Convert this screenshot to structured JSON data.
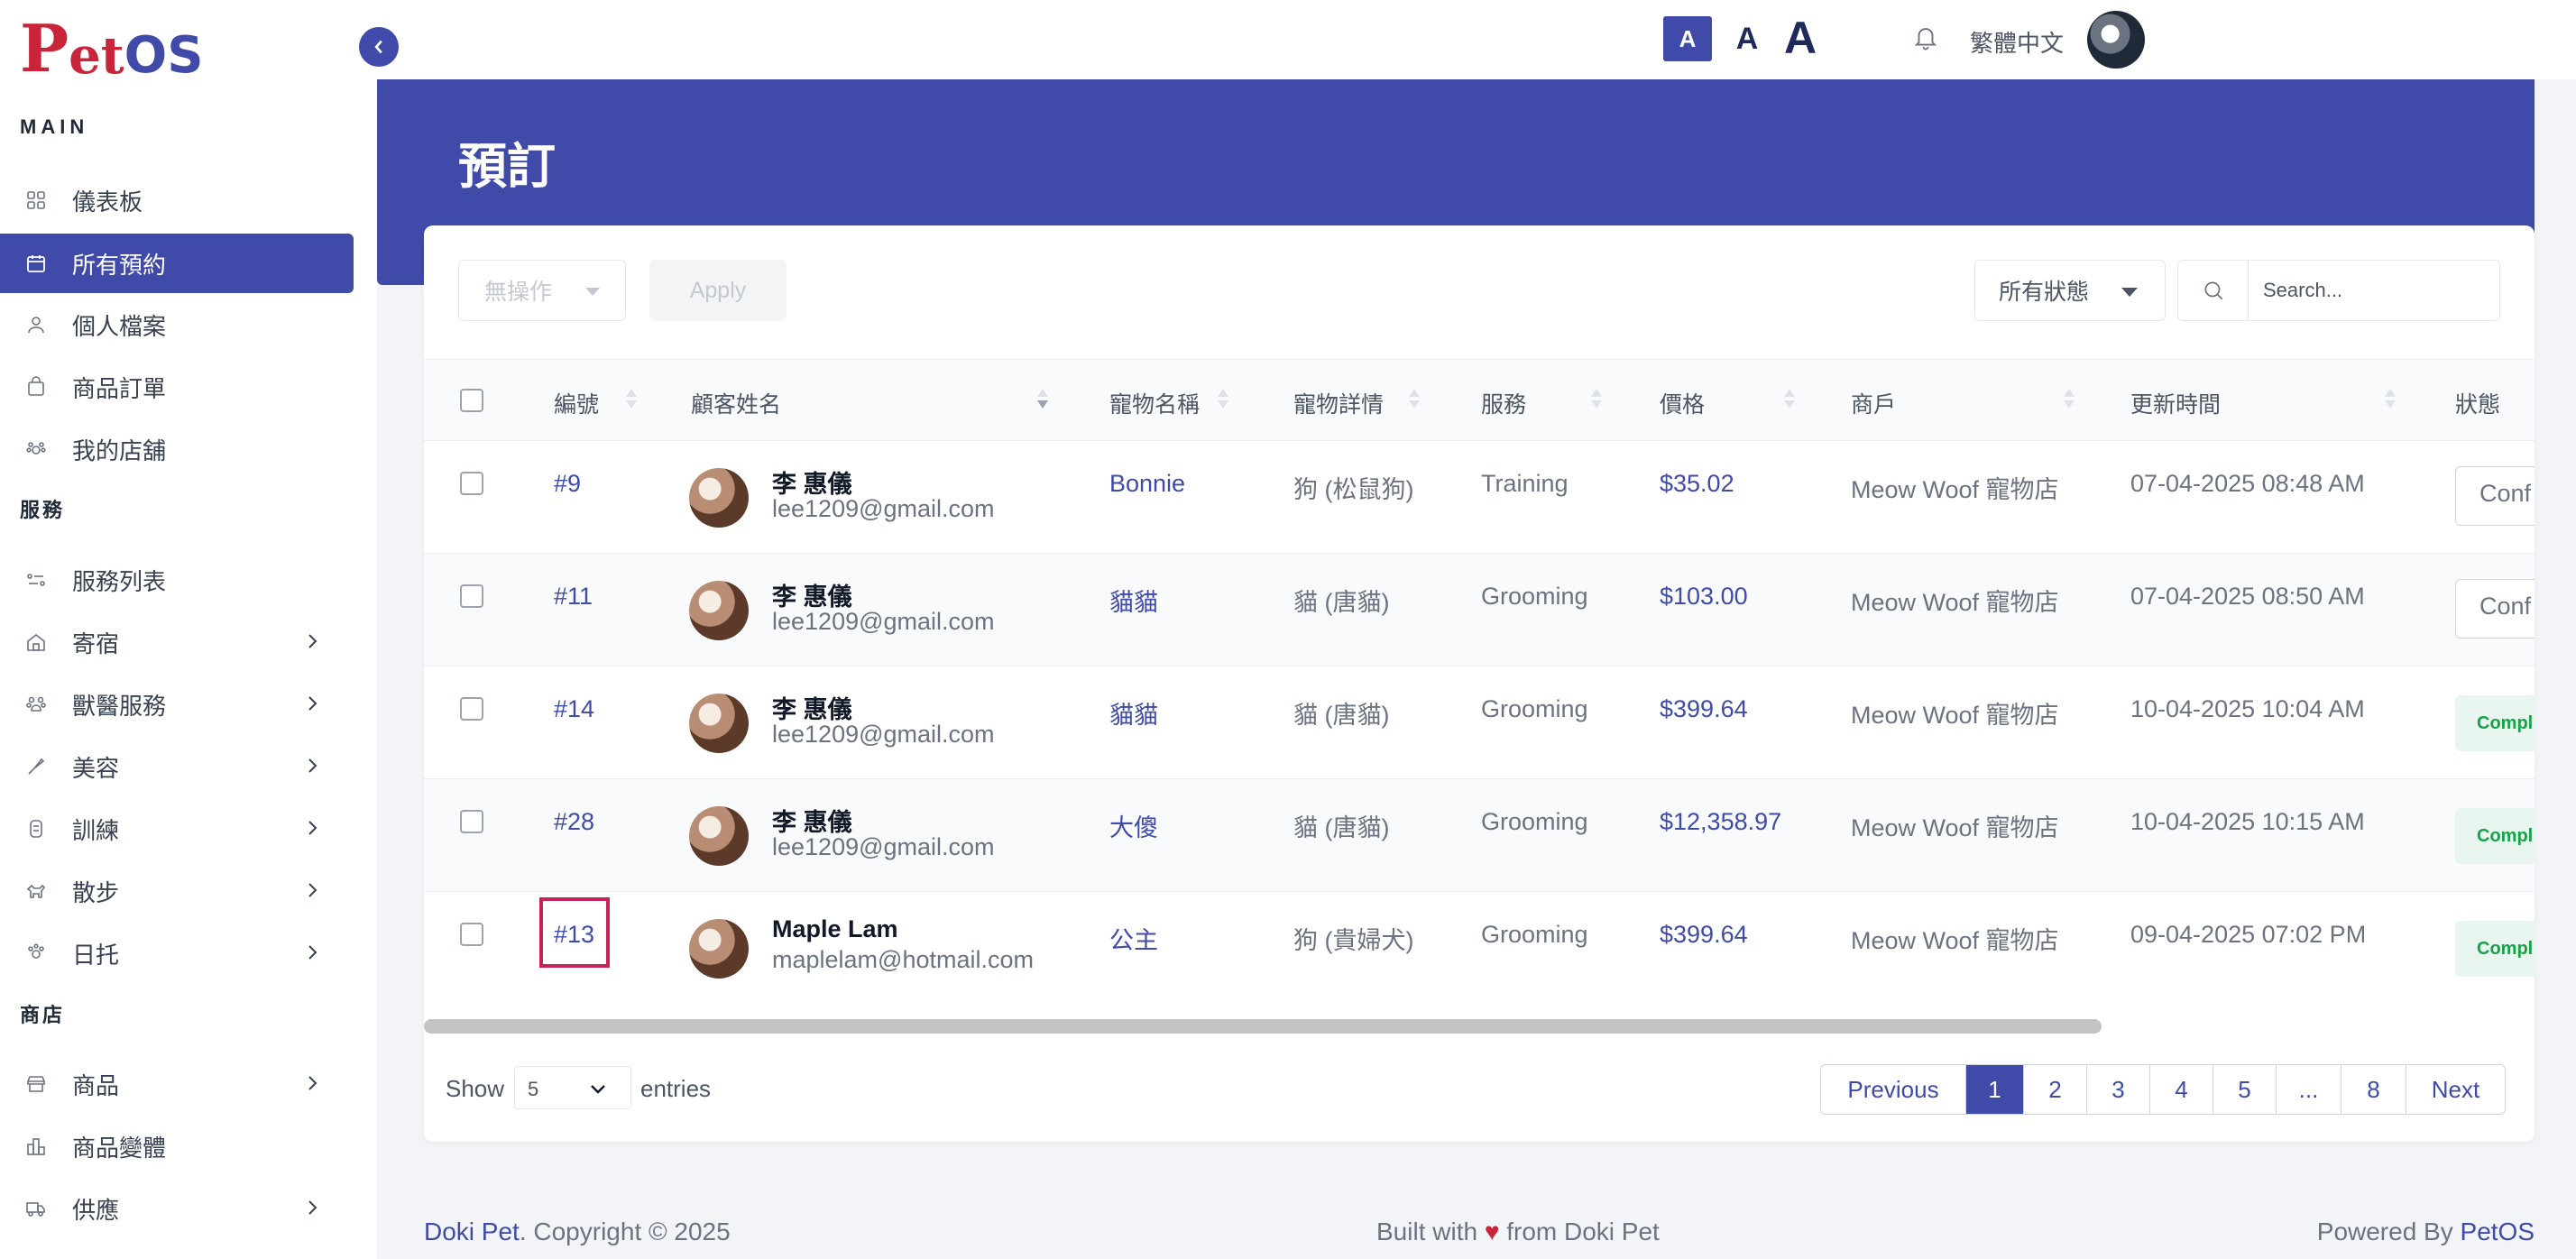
{
  "brand": {
    "logo_p": "P",
    "logo_et": "et",
    "logo_os": "OS"
  },
  "topbar": {
    "font_small": "A",
    "font_medium": "A",
    "font_large": "A",
    "language": "繁體中文"
  },
  "sidebar": {
    "sections": [
      {
        "label": "MAIN"
      },
      {
        "label": "服務"
      },
      {
        "label": "商店"
      }
    ],
    "items": [
      {
        "label": "儀表板",
        "icon": "dashboard-icon",
        "active": false,
        "has_children": false
      },
      {
        "label": "所有預約",
        "icon": "calendar-icon",
        "active": true,
        "has_children": false
      },
      {
        "label": "個人檔案",
        "icon": "user-icon",
        "active": false,
        "has_children": false
      },
      {
        "label": "商品訂單",
        "icon": "bag-icon",
        "active": false,
        "has_children": false
      },
      {
        "label": "我的店舖",
        "icon": "store-icon",
        "active": false,
        "has_children": false
      },
      {
        "label": "服務列表",
        "icon": "list-icon",
        "active": false,
        "has_children": false
      },
      {
        "label": "寄宿",
        "icon": "home-icon",
        "active": false,
        "has_children": true
      },
      {
        "label": "獸醫服務",
        "icon": "vet-icon",
        "active": false,
        "has_children": true
      },
      {
        "label": "美容",
        "icon": "grooming-icon",
        "active": false,
        "has_children": true
      },
      {
        "label": "訓練",
        "icon": "training-icon",
        "active": false,
        "has_children": true
      },
      {
        "label": "散步",
        "icon": "walk-icon",
        "active": false,
        "has_children": true
      },
      {
        "label": "日托",
        "icon": "daycare-icon",
        "active": false,
        "has_children": true
      },
      {
        "label": "商品",
        "icon": "shop-icon",
        "active": false,
        "has_children": true
      },
      {
        "label": "商品變體",
        "icon": "variant-icon",
        "active": false,
        "has_children": false
      },
      {
        "label": "供應",
        "icon": "truck-icon",
        "active": false,
        "has_children": true
      }
    ]
  },
  "page": {
    "title": "預訂"
  },
  "toolbar": {
    "bulk_action": "無操作",
    "apply_label": "Apply",
    "status_filter": "所有狀態",
    "search_placeholder": "Search..."
  },
  "table": {
    "columns": [
      "編號",
      "顧客姓名",
      "寵物名稱",
      "寵物詳情",
      "服務",
      "價格",
      "商戶",
      "更新時間",
      "狀態"
    ],
    "rows": [
      {
        "id": "#9",
        "customer": "李 惠儀",
        "email": "lee1209@gmail.com",
        "pet": "Bonnie",
        "details": "狗 (松鼠狗)",
        "service": "Training",
        "price": "$35.02",
        "merchant": "Meow Woof 寵物店",
        "updated": "07-04-2025 08:48 AM",
        "status": "Conf"
      },
      {
        "id": "#11",
        "customer": "李 惠儀",
        "email": "lee1209@gmail.com",
        "pet": "貓貓",
        "details": "貓 (唐貓)",
        "service": "Grooming",
        "price": "$103.00",
        "merchant": "Meow Woof 寵物店",
        "updated": "07-04-2025 08:50 AM",
        "status": "Conf"
      },
      {
        "id": "#14",
        "customer": "李 惠儀",
        "email": "lee1209@gmail.com",
        "pet": "貓貓",
        "details": "貓 (唐貓)",
        "service": "Grooming",
        "price": "$399.64",
        "merchant": "Meow Woof 寵物店",
        "updated": "10-04-2025 10:04 AM",
        "status": "Compl"
      },
      {
        "id": "#28",
        "customer": "李 惠儀",
        "email": "lee1209@gmail.com",
        "pet": "大傻",
        "details": "貓 (唐貓)",
        "service": "Grooming",
        "price": "$12,358.97",
        "merchant": "Meow Woof 寵物店",
        "updated": "10-04-2025 10:15 AM",
        "status": "Compl"
      },
      {
        "id": "#13",
        "customer": "Maple Lam",
        "email": "maplelam@hotmail.com",
        "pet": "公主",
        "details": "狗 (貴婦犬)",
        "service": "Grooming",
        "price": "$399.64",
        "merchant": "Meow Woof 寵物店",
        "updated": "09-04-2025 07:02 PM",
        "status": "Compl"
      }
    ]
  },
  "pagination": {
    "show_label": "Show",
    "page_size": "5",
    "entries_label": "entries",
    "previous": "Previous",
    "pages": [
      "1",
      "2",
      "3",
      "4",
      "5",
      "...",
      "8"
    ],
    "current": "1",
    "next": "Next"
  },
  "footer": {
    "brand": "Doki Pet",
    "copyright": ". Copyright © 2025",
    "built_prefix": "Built with",
    "heart": "♥",
    "built_suffix": "from Doki Pet",
    "powered_prefix": "Powered By",
    "powered_brand": "PetOS"
  },
  "colors": {
    "primary": "#3f4aa9",
    "brand_red": "#c8243a",
    "success": "#16a34a"
  }
}
